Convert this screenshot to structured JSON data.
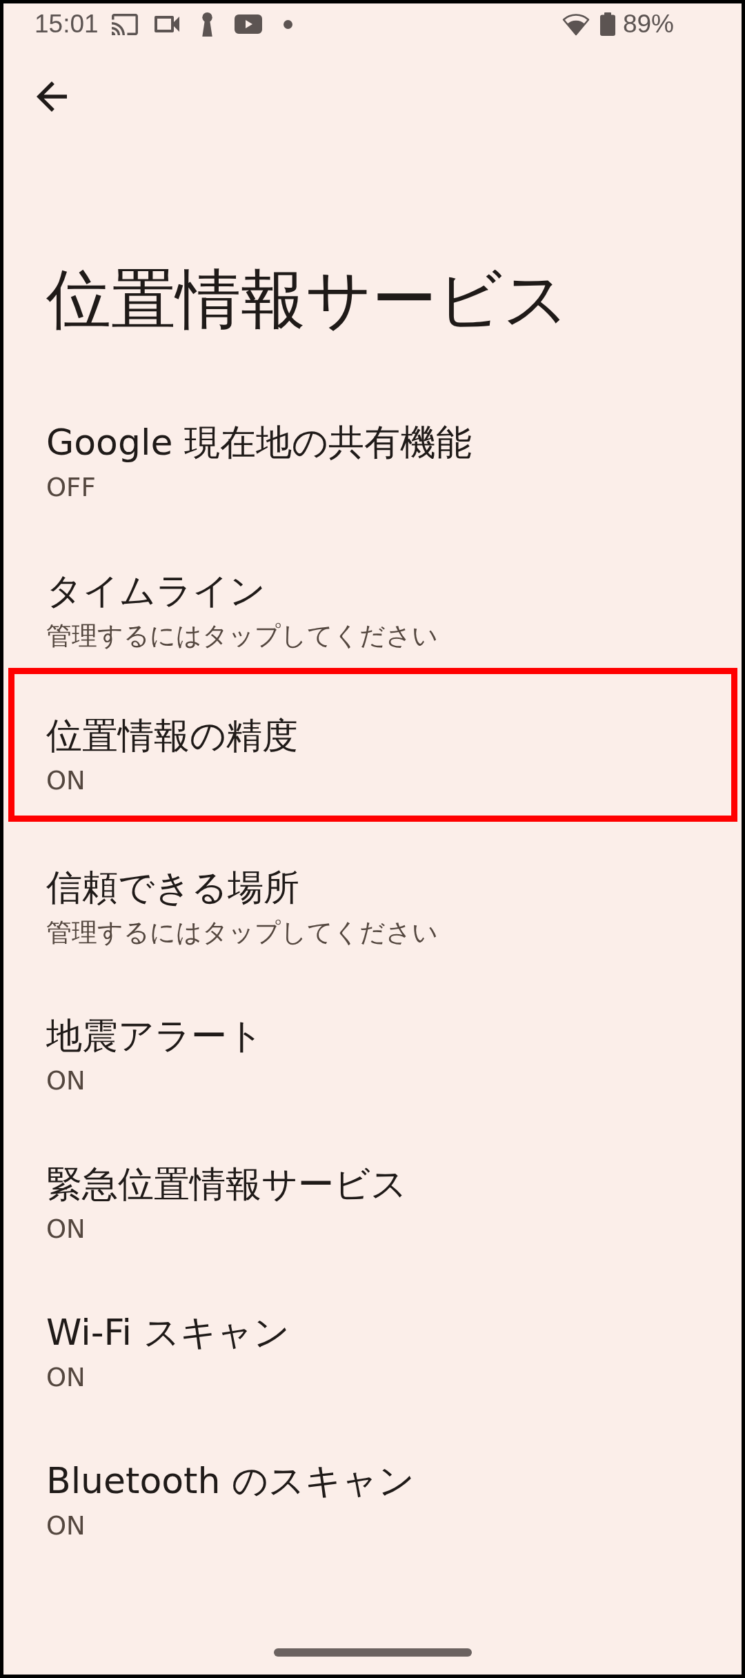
{
  "status_bar": {
    "time": "15:01",
    "battery": "89%"
  },
  "title": "位置情報サービス",
  "items": [
    {
      "title": "Google 現在地の共有機能",
      "summary": "OFF",
      "highlighted": false
    },
    {
      "title": "タイムライン",
      "summary": "管理するにはタップしてください",
      "highlighted": false
    },
    {
      "title": "位置情報の精度",
      "summary": "ON",
      "highlighted": true
    },
    {
      "title": "信頼できる場所",
      "summary": "管理するにはタップしてください",
      "highlighted": false
    },
    {
      "title": "地震アラート",
      "summary": "ON",
      "highlighted": false
    },
    {
      "title": "緊急位置情報サービス",
      "summary": "ON",
      "highlighted": false
    },
    {
      "title": "Wi-Fi スキャン",
      "summary": "ON",
      "highlighted": false
    },
    {
      "title": "Bluetooth のスキャン",
      "summary": "ON",
      "highlighted": false
    }
  ]
}
